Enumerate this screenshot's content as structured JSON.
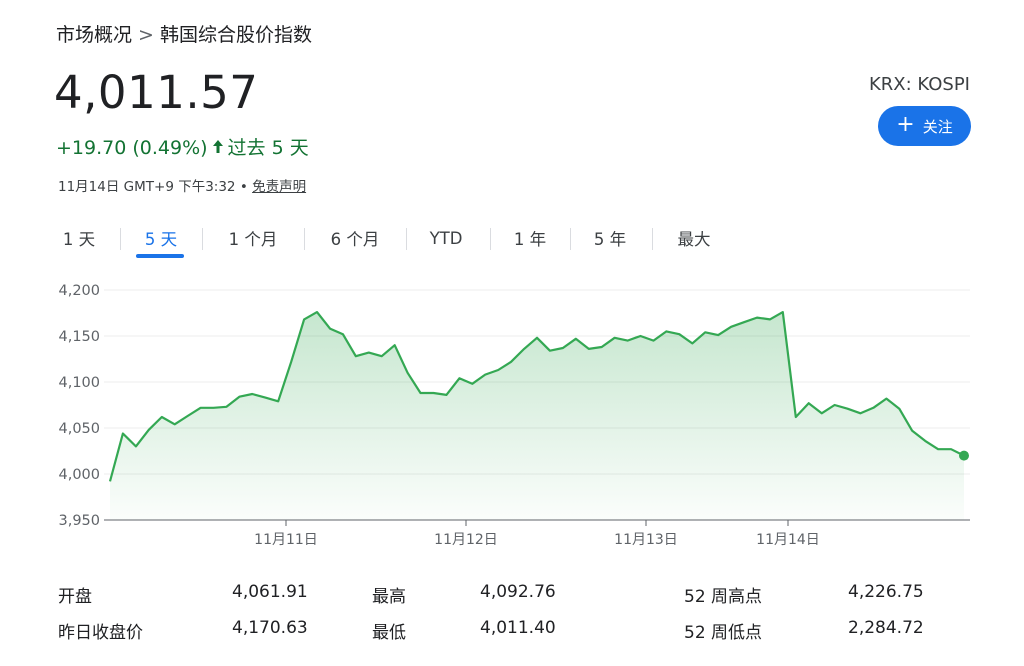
{
  "breadcrumb": {
    "parent": "市场概况",
    "separator": ">",
    "current": "韩国综合股价指数"
  },
  "quote": {
    "price": "4,011.57",
    "change": "+19.70 (0.49%)",
    "period": "过去 5 天",
    "timestamp": "11月14日 GMT+9 下午3:32",
    "separator": "•",
    "disclaimer": "免责声明",
    "exchange": "KRX: KOSPI",
    "up_color": "#137333"
  },
  "follow_button": {
    "label": "关注",
    "icon": "plus-icon",
    "color": "#1a73e8"
  },
  "tabs": [
    {
      "label": "1 天",
      "active": false
    },
    {
      "label": "5 天",
      "active": true
    },
    {
      "label": "1 个月",
      "active": false
    },
    {
      "label": "6 个月",
      "active": false
    },
    {
      "label": "YTD",
      "active": false
    },
    {
      "label": "1 年",
      "active": false
    },
    {
      "label": "5 年",
      "active": false
    },
    {
      "label": "最大",
      "active": false
    }
  ],
  "chart_data": {
    "type": "area",
    "x_labels": [
      "11月11日",
      "11月12日",
      "11月13日",
      "11月14日"
    ],
    "y_ticks": [
      "4,200",
      "4,150",
      "4,100",
      "4,050",
      "4,000",
      "3,950"
    ],
    "ylim": [
      3950,
      4200
    ],
    "grid": true,
    "line_color": "#34a853",
    "series": [
      {
        "values": [
          3992,
          4044,
          4030,
          4048,
          4062,
          4054,
          4063,
          4072,
          4072,
          4073,
          4084,
          4087,
          4083,
          4079,
          4122,
          4168,
          4176,
          4158,
          4152,
          4128,
          4132,
          4128,
          4140,
          4110,
          4088,
          4088,
          4086,
          4104,
          4098,
          4108,
          4113,
          4122,
          4136,
          4148,
          4134,
          4137,
          4147,
          4136,
          4138,
          4148,
          4145,
          4150,
          4145,
          4155,
          4152,
          4142,
          4154,
          4151,
          4160,
          4165,
          4170,
          4168,
          4176,
          4062,
          4077,
          4066,
          4075,
          4071,
          4066,
          4072,
          4082,
          4071,
          4047,
          4036,
          4027,
          4027,
          4020
        ]
      }
    ]
  },
  "stats": {
    "open_label": "开盘",
    "open_value": "4,061.91",
    "prev_close_label": "昨日收盘价",
    "prev_close_value": "4,170.63",
    "high_label": "最高",
    "high_value": "4,092.76",
    "low_label": "最低",
    "low_value": "4,011.40",
    "w52_high_label": "52 周高点",
    "w52_high_value": "4,226.75",
    "w52_low_label": "52 周低点",
    "w52_low_value": "2,284.72"
  }
}
